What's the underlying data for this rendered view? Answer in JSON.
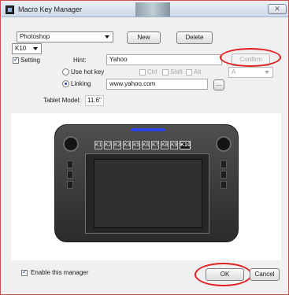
{
  "window": {
    "title": "Macro Key Manager",
    "close_symbol": "✕"
  },
  "controls": {
    "application_select": "Photoshop",
    "key_select": "K10",
    "new_label": "New",
    "delete_label": "Delete",
    "setting_label": "Setting",
    "hint_label": "Hint:",
    "hint_value": "Yahoo",
    "confirm_label": "Confirm",
    "use_hot_key_label": "Use hot key",
    "ctrl_label": "Ctrl",
    "shift_label": "Shift",
    "alt_label": "Alt",
    "hotkey_select": "A",
    "linking_label": "Linking",
    "linking_value": "www.yahoo.com",
    "browse_label": "...",
    "tablet_model_label": "Tablet Model:",
    "tablet_model_value": "11.6\""
  },
  "tablet": {
    "keys": [
      "K1",
      "K2",
      "K3",
      "K4",
      "K5",
      "K6",
      "K7",
      "K8",
      "K9",
      "K10"
    ],
    "active_key": "K10"
  },
  "footer": {
    "enable_label": "Enable this manager",
    "ok_label": "OK",
    "cancel_label": "Cancel"
  },
  "colors": {
    "accent_ring": "#e02020",
    "tablet_glow": "#2f45e8"
  }
}
